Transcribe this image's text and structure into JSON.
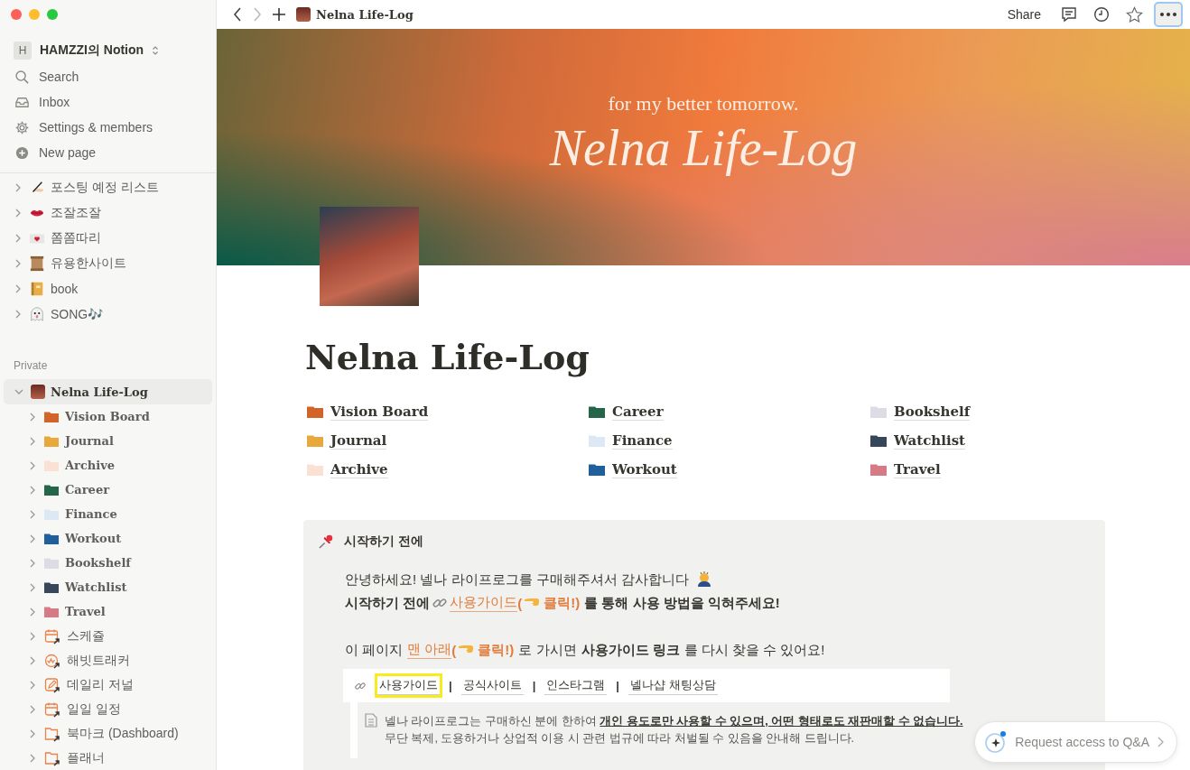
{
  "sidebar": {
    "workspace": {
      "initial": "H",
      "name": "HAMZZI의 Notion"
    },
    "nav": [
      {
        "kind": "search",
        "label": "Search"
      },
      {
        "kind": "inbox",
        "label": "Inbox"
      },
      {
        "kind": "settings",
        "label": "Settings & members"
      },
      {
        "kind": "new",
        "label": "New page"
      }
    ],
    "pages": [
      {
        "kind": "writing",
        "label": "포스팅 예정 리스트"
      },
      {
        "kind": "lips",
        "label": "조잘조잘"
      },
      {
        "kind": "letter",
        "label": "쫌쫌따리"
      },
      {
        "kind": "scroll",
        "label": "유용한사이트"
      },
      {
        "kind": "book",
        "label": "book"
      },
      {
        "kind": "ghost",
        "label": "SONG🎶"
      }
    ],
    "private_label": "Private",
    "private": {
      "label": "Nelna Life-Log",
      "expanded": true,
      "selected": true,
      "children": [
        {
          "kind": "folder",
          "label": "Vision Board",
          "color": "#d2642a"
        },
        {
          "kind": "folder",
          "label": "Journal",
          "color": "#e8a93c"
        },
        {
          "kind": "folder",
          "label": "Archive",
          "color": "#fbe1d3"
        },
        {
          "kind": "folder",
          "label": "Career",
          "color": "#24664a"
        },
        {
          "kind": "folder",
          "label": "Finance",
          "color": "#dde8f5"
        },
        {
          "kind": "folder",
          "label": "Workout",
          "color": "#1f5f9c"
        },
        {
          "kind": "folder",
          "label": "Bookshelf",
          "color": "#dddbe4"
        },
        {
          "kind": "folder",
          "label": "Watchlist",
          "color": "#36475c"
        },
        {
          "kind": "folder",
          "label": "Travel",
          "color": "#d67b86"
        },
        {
          "kind": "calendar",
          "label": "스케쥴"
        },
        {
          "kind": "habit",
          "label": "해빗트래커"
        },
        {
          "kind": "edit",
          "label": "데일리 저널"
        },
        {
          "kind": "calendar",
          "label": "일일 일정"
        },
        {
          "kind": "folder-link",
          "label": "북마크 (Dashboard)"
        },
        {
          "kind": "folder-link",
          "label": "플래너"
        }
      ]
    }
  },
  "topbar": {
    "title": "Nelna Life-Log",
    "share": "Share"
  },
  "cover": {
    "subtitle": "for my better tomorrow.",
    "title": "Nelna Life-Log"
  },
  "page": {
    "title": "Nelna Life-Log",
    "links": [
      {
        "label": "Vision Board",
        "color": "#d2642a"
      },
      {
        "label": "Journal",
        "color": "#e8a93c"
      },
      {
        "label": "Archive",
        "color": "#fbe1d3"
      },
      {
        "label": "Career",
        "color": "#24664a"
      },
      {
        "label": "Finance",
        "color": "#dde8f5"
      },
      {
        "label": "Workout",
        "color": "#1f5f9c"
      },
      {
        "label": "Bookshelf",
        "color": "#dddbe4"
      },
      {
        "label": "Watchlist",
        "color": "#36475c"
      },
      {
        "label": "Travel",
        "color": "#d67b86"
      }
    ],
    "callout": {
      "title": "시작하기 전에",
      "lines": [
        [
          {
            "kind": "text",
            "text": "안녕하세요! 넬나 라이프로그를 구매해주셔서 감사합니다"
          },
          {
            "kind": "bow"
          }
        ],
        [
          {
            "kind": "bold",
            "text": "시작하기 전에"
          },
          {
            "kind": "chain"
          },
          {
            "kind": "link",
            "text": "사용가이드"
          },
          {
            "kind": "link-bold",
            "text": "("
          },
          {
            "kind": "hand"
          },
          {
            "kind": "link-bold",
            "text": "클릭!)"
          },
          {
            "kind": "bold",
            "text": "를 통해 사용 방법을 익혀주세요!"
          }
        ],
        [
          {
            "kind": "text",
            "text": "이 페이지"
          },
          {
            "kind": "link",
            "text": "맨 아래"
          },
          {
            "kind": "link-bold",
            "text": "("
          },
          {
            "kind": "hand"
          },
          {
            "kind": "link-bold",
            "text": "클릭!)"
          },
          {
            "kind": "text",
            "text": "로 가시면"
          },
          {
            "kind": "bold",
            "text": "사용가이드 링크"
          },
          {
            "kind": "text",
            "text": "를 다시 찾을 수 있어요!"
          }
        ]
      ],
      "separator": "|",
      "quick_links": [
        {
          "label": "사용가이드",
          "highlighted": true
        },
        {
          "label": "공식사이트",
          "highlighted": false
        },
        {
          "label": "인스타그램",
          "highlighted": false
        },
        {
          "label": "넬나샵 채팅상담",
          "highlighted": false
        }
      ],
      "notice": [
        "넬나 라이프로그는 구매하신 분에 한하여 **개인 용도로만 사용할 수 있으며, 어떤 형태로도 재판매할 수 없습니다.**",
        "무단 복제, 도용하거나 상업적 이용 시 관련 법규에 따라 처벌될 수 있음을 안내해 드립니다."
      ]
    }
  },
  "qa_button": {
    "label": "Request access to Q&A",
    "unread": true
  }
}
